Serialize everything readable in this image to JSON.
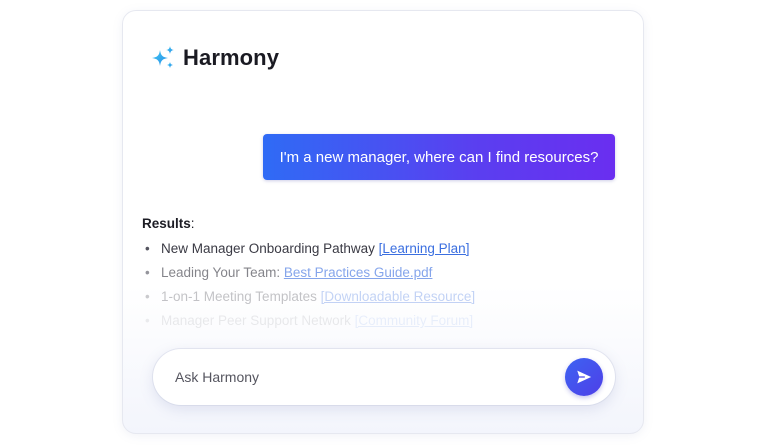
{
  "app": {
    "name": "Harmony",
    "icon": "sparkles-icon",
    "accent_color": "#4f46e5"
  },
  "conversation": {
    "user_message": "I'm a new manager, where can I find resources?"
  },
  "results": {
    "heading": "Results",
    "heading_suffix": ":",
    "items": [
      {
        "text": "New Manager Onboarding Pathway ",
        "link": "[Learning Plan]"
      },
      {
        "text": "Leading Your Team: ",
        "link": "Best Practices Guide.pdf"
      },
      {
        "text": "1-on-1 Meeting Templates ",
        "link": "[Downloadable Resource]"
      },
      {
        "text": "Manager Peer Support Network ",
        "link": "[Community Forum]"
      }
    ]
  },
  "input": {
    "placeholder": "Ask Harmony",
    "value": "",
    "send_icon": "send-icon"
  }
}
